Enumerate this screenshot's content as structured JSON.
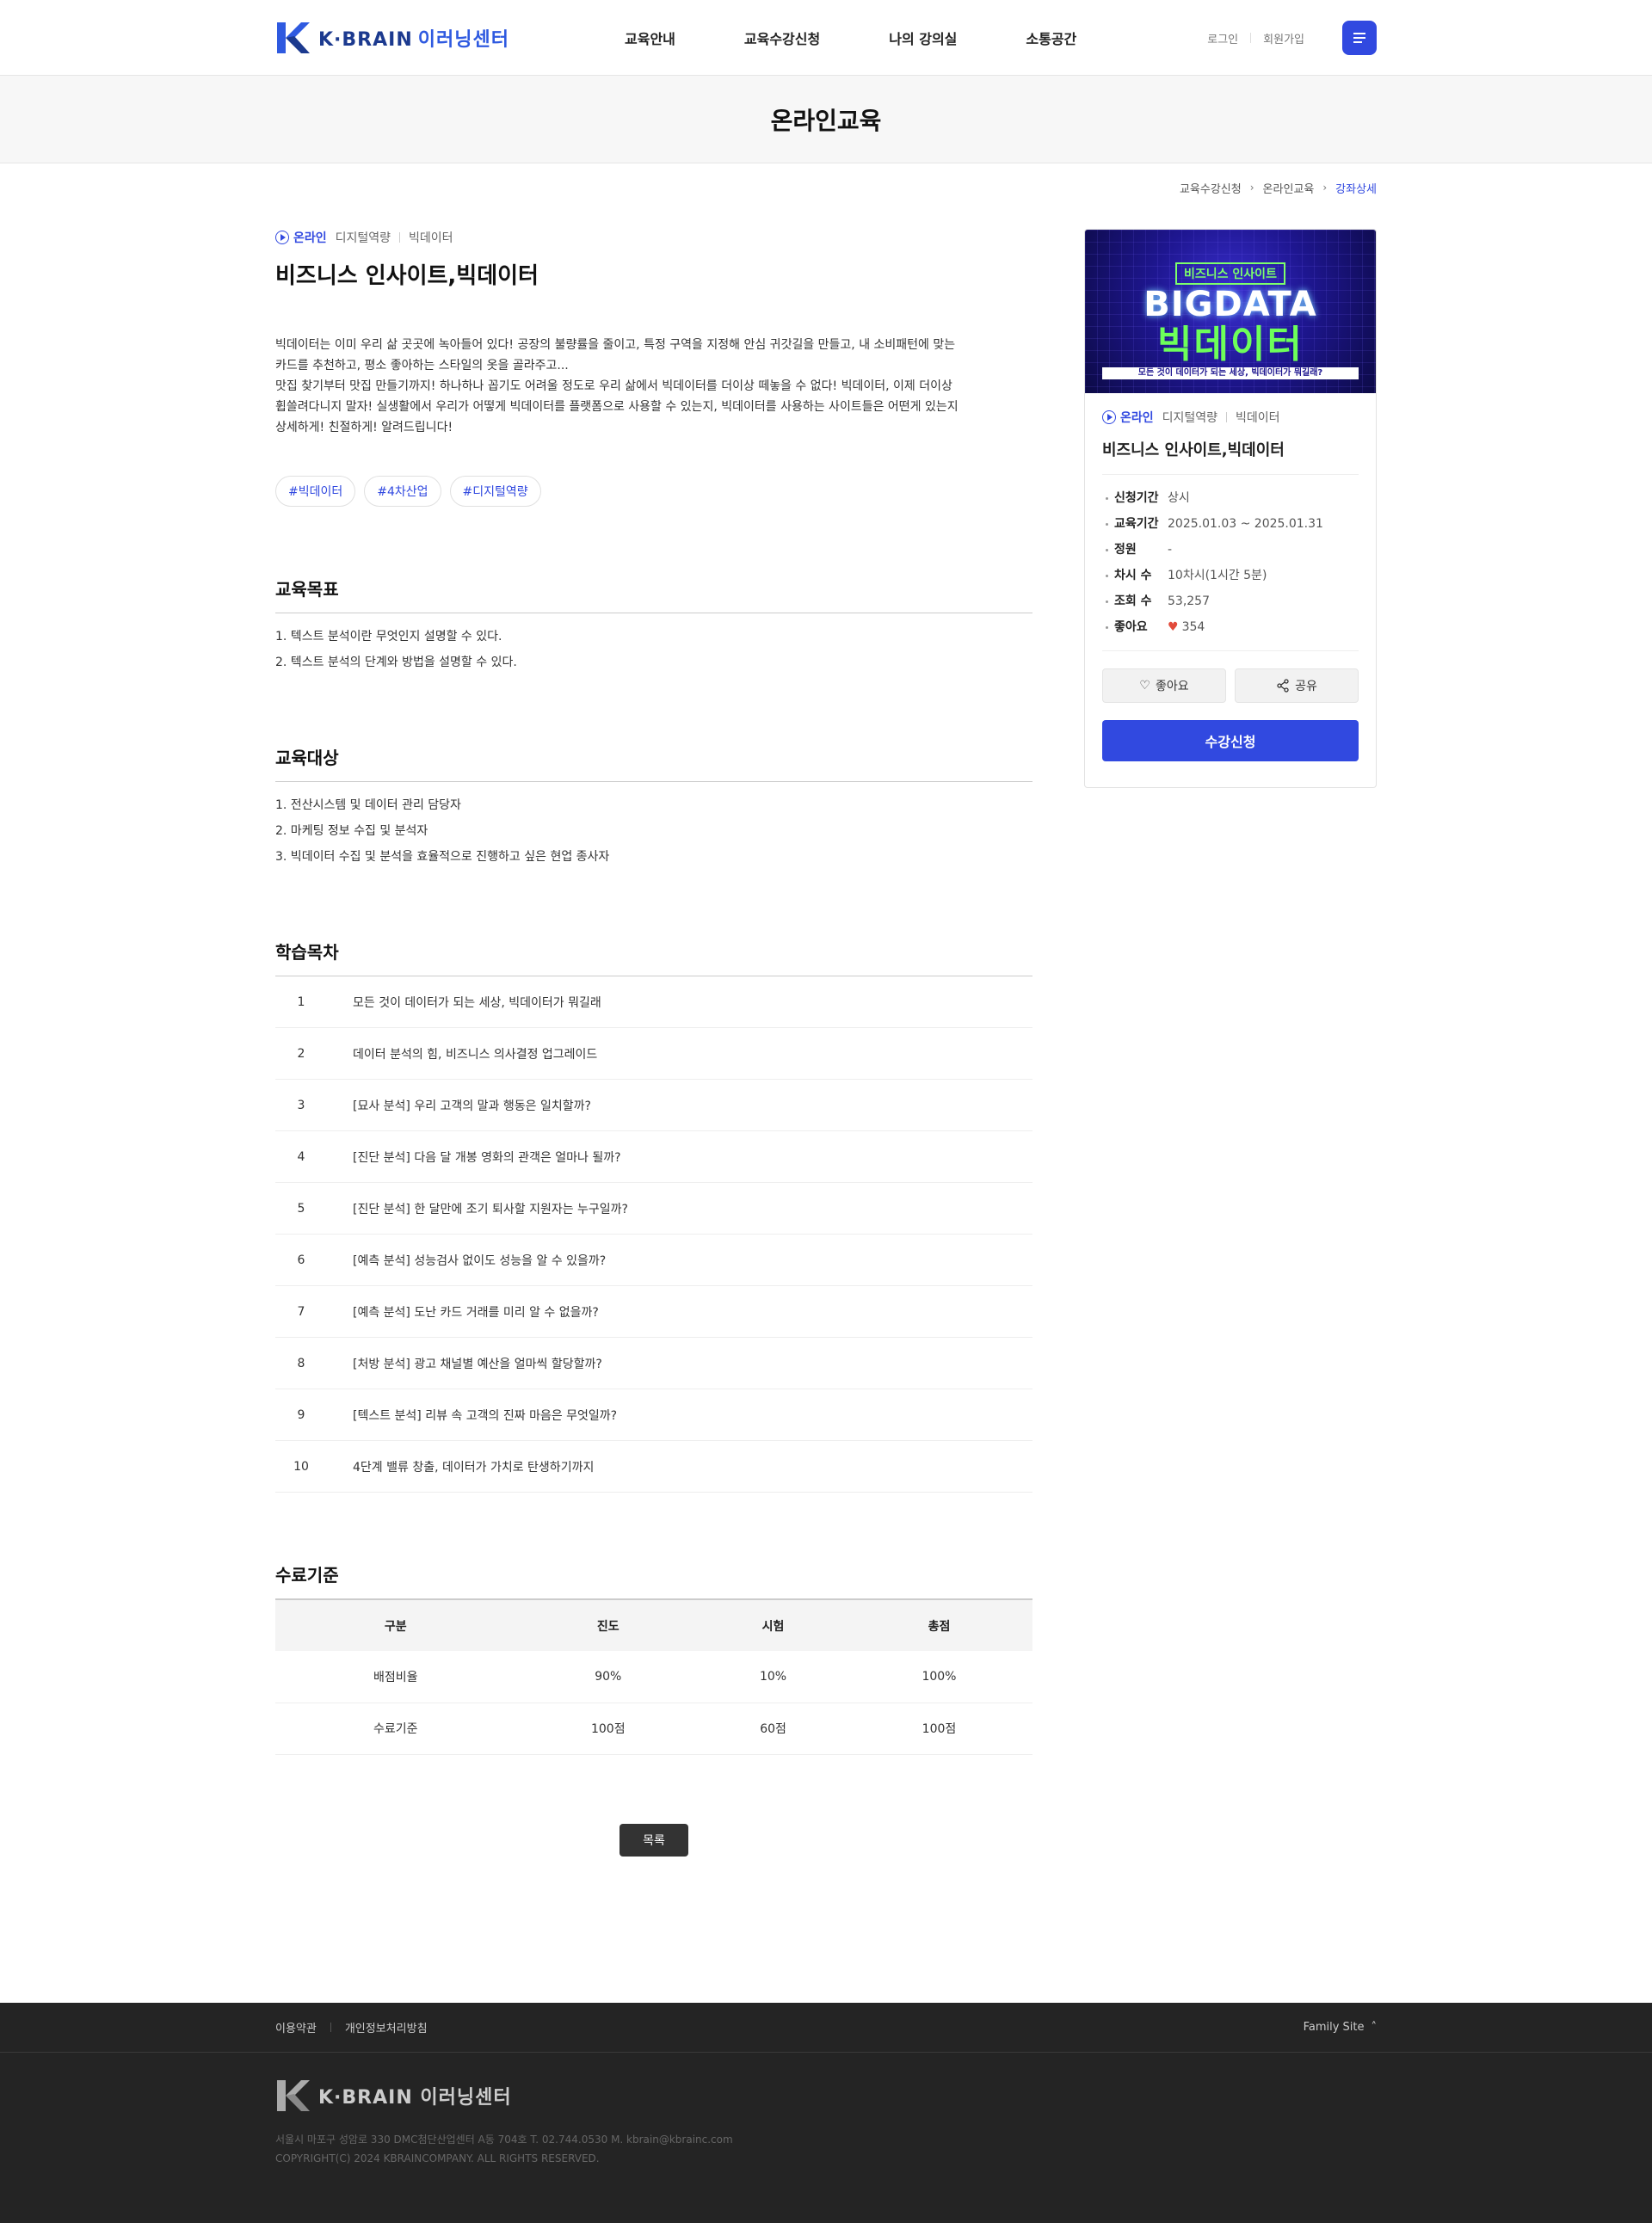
{
  "header": {
    "logo_text": "K·BRAIN",
    "logo_sub": "이러닝센터",
    "nav": [
      "교육안내",
      "교육수강신청",
      "나의 강의실",
      "소통공간"
    ],
    "login": "로그인",
    "signup": "회원가입"
  },
  "page_title": "온라인교육",
  "breadcrumb": [
    "교육수강신청",
    "온라인교육",
    "강좌상세"
  ],
  "course": {
    "type": "온라인",
    "category1": "디지털역량",
    "category2": "빅데이터",
    "title": "비즈니스 인사이트,빅데이터",
    "description": [
      "빅데이터는 이미 우리 삶 곳곳에 녹아들어 있다! 공장의 불량률을 줄이고, 특정 구역을 지정해 안심 귀갓길을 만들고, 내 소비패턴에 맞는",
      "카드를 추천하고, 평소 좋아하는 스타일의 옷을 골라주고...",
      "맛집 찾기부터 맛집 만들기까지! 하나하나 꼽기도 어려울 정도로 우리 삶에서 빅데이터를 더이상 떼놓을 수 없다! 빅데이터, 이제 더이상",
      "휩쓸려다니지 말자! 실생활에서 우리가 어떻게 빅데이터를 플랫폼으로 사용할 수 있는지, 빅데이터를 사용하는 사이트들은 어떤게 있는지",
      "상세하게! 친절하게! 알려드립니다!"
    ],
    "tags": [
      "#빅데이터",
      "#4차산업",
      "#디지털역량"
    ]
  },
  "goals": {
    "heading": "교육목표",
    "items": [
      "1. 텍스트 분석이란 무엇인지 설명할 수 있다.",
      "2. 텍스트 분석의 단계와 방법을 설명할 수 있다."
    ]
  },
  "targets": {
    "heading": "교육대상",
    "items": [
      "1. 전산시스템 및 데이터 관리 담당자",
      "2. 마케팅 정보 수집 및 분석자",
      "3. 빅데이터 수집 및 분석을 효율적으로 진행하고 싶은 현업 종사자"
    ]
  },
  "toc": {
    "heading": "학습목차",
    "rows": [
      {
        "no": "1",
        "title": "모든 것이 데이터가 되는 세상, 빅데이터가 뭐길래"
      },
      {
        "no": "2",
        "title": "데이터 분석의 힘, 비즈니스 의사결정 업그레이드"
      },
      {
        "no": "3",
        "title": "[묘사 분석] 우리 고객의 말과 행동은 일치할까?"
      },
      {
        "no": "4",
        "title": "[진단 분석] 다음 달 개봉 영화의 관객은 얼마나 될까?"
      },
      {
        "no": "5",
        "title": "[진단 분석] 한 달만에 조기 퇴사할 지원자는 누구일까?"
      },
      {
        "no": "6",
        "title": "[예측 분석] 성능검사 없이도 성능을 알 수 있을까?"
      },
      {
        "no": "7",
        "title": "[예측 분석] 도난 카드 거래를 미리 알 수 없을까?"
      },
      {
        "no": "8",
        "title": "[처방 분석] 광고 채널별 예산을 얼마씩 할당할까?"
      },
      {
        "no": "9",
        "title": "[텍스트 분석] 리뷰 속 고객의 진짜 마음은 무엇일까?"
      },
      {
        "no": "10",
        "title": "4단계 밸류 창출, 데이터가 가치로 탄생하기까지"
      }
    ]
  },
  "criteria": {
    "heading": "수료기준",
    "columns": [
      "구분",
      "진도",
      "시험",
      "총점"
    ],
    "rows": [
      [
        "배점비율",
        "90%",
        "10%",
        "100%"
      ],
      [
        "수료기준",
        "100점",
        "60점",
        "100점"
      ]
    ]
  },
  "list_button": "목록",
  "side": {
    "thumb_kicker": "비즈니스 인사이트",
    "thumb_title": "BIGDATA",
    "thumb_ko": "빅데이터",
    "thumb_foot": "모든 것이 데이터가 되는 세상, 빅데이터가 뭐길래?",
    "info": [
      {
        "k": "신청기간",
        "v": "상시"
      },
      {
        "k": "교육기간",
        "v": "2025.01.03 ~ 2025.01.31"
      },
      {
        "k": "정원",
        "v": "-"
      },
      {
        "k": "차시 수",
        "v": "10차시(1시간 5분)"
      },
      {
        "k": "조회 수",
        "v": "53,257"
      },
      {
        "k": "좋아요",
        "v": "354"
      }
    ],
    "like_button": "좋아요",
    "share_button": "공유",
    "apply_button": "수강신청"
  },
  "footer": {
    "terms": "이용약관",
    "privacy": "개인정보처리방침",
    "family": "Family Site",
    "address": "서울시 마포구 성암로 330 DMC첨단산업센터 A동 704호 T. 02.744.0530 M. kbrain@kbrainc.com",
    "copyright": "COPYRIGHT(C) 2024 KBRAINCOMPANY. ALL RIGHTS RESERVED."
  },
  "colors": {
    "accent": "#3149e0",
    "footer_bg": "#242424",
    "like": "#e24b3b"
  }
}
